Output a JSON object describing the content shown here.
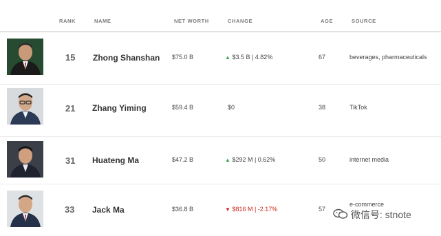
{
  "header": {
    "rank": "RANK",
    "name": "NAME",
    "net_worth": "NET WORTH",
    "change": "CHANGE",
    "age": "AGE",
    "source": "SOURCE"
  },
  "rows": [
    {
      "rank": "15",
      "name": "Zhong Shanshan",
      "net_worth": "$75.0 B",
      "change": "$3.5 B | 4.82%",
      "direction": "up",
      "age": "67",
      "source": "beverages, pharmaceuticals"
    },
    {
      "rank": "21",
      "name": "Zhang Yiming",
      "net_worth": "$59.4 B",
      "change": "$0",
      "direction": "none",
      "age": "38",
      "source": "TikTok"
    },
    {
      "rank": "31",
      "name": "Huateng Ma",
      "net_worth": "$47.2 B",
      "change": "$292 M | 0.62%",
      "direction": "up",
      "age": "50",
      "source": "internet media"
    },
    {
      "rank": "33",
      "name": "Jack Ma",
      "net_worth": "$36.8 B",
      "change": "$816 M | -2.17%",
      "direction": "down",
      "age": "57",
      "source": "e-commerce"
    }
  ],
  "watermark": {
    "text": "微信号: stnote"
  },
  "colors": {
    "up": "#2ea84a",
    "down": "#d0241c"
  },
  "icons": {
    "up": "triangle-up-icon",
    "down": "triangle-down-icon",
    "watermark": "wechat-icon"
  }
}
